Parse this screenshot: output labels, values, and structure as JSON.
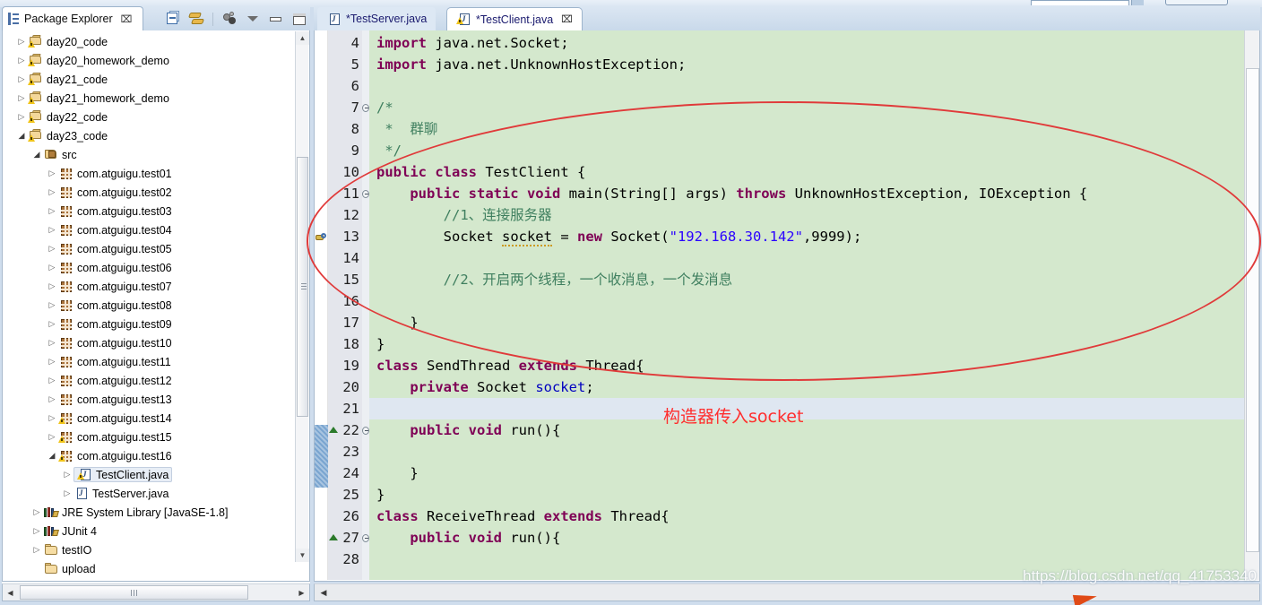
{
  "explorer": {
    "title": "Package Explorer",
    "close_glyph": "⌧",
    "tree": [
      {
        "label": "day20_code",
        "indent": 0,
        "arrow": "closed",
        "icon": "project-warning"
      },
      {
        "label": "day20_homework_demo",
        "indent": 0,
        "arrow": "closed",
        "icon": "project-warning"
      },
      {
        "label": "day21_code",
        "indent": 0,
        "arrow": "closed",
        "icon": "project-warning"
      },
      {
        "label": "day21_homework_demo",
        "indent": 0,
        "arrow": "closed",
        "icon": "project-warning"
      },
      {
        "label": "day22_code",
        "indent": 0,
        "arrow": "closed",
        "icon": "project-warning"
      },
      {
        "label": "day23_code",
        "indent": 0,
        "arrow": "open",
        "icon": "project-warning"
      },
      {
        "label": "src",
        "indent": 1,
        "arrow": "open",
        "icon": "source-folder"
      },
      {
        "label": "com.atguigu.test01",
        "indent": 2,
        "arrow": "closed",
        "icon": "package"
      },
      {
        "label": "com.atguigu.test02",
        "indent": 2,
        "arrow": "closed",
        "icon": "package"
      },
      {
        "label": "com.atguigu.test03",
        "indent": 2,
        "arrow": "closed",
        "icon": "package"
      },
      {
        "label": "com.atguigu.test04",
        "indent": 2,
        "arrow": "closed",
        "icon": "package"
      },
      {
        "label": "com.atguigu.test05",
        "indent": 2,
        "arrow": "closed",
        "icon": "package"
      },
      {
        "label": "com.atguigu.test06",
        "indent": 2,
        "arrow": "closed",
        "icon": "package"
      },
      {
        "label": "com.atguigu.test07",
        "indent": 2,
        "arrow": "closed",
        "icon": "package"
      },
      {
        "label": "com.atguigu.test08",
        "indent": 2,
        "arrow": "closed",
        "icon": "package"
      },
      {
        "label": "com.atguigu.test09",
        "indent": 2,
        "arrow": "closed",
        "icon": "package"
      },
      {
        "label": "com.atguigu.test10",
        "indent": 2,
        "arrow": "closed",
        "icon": "package"
      },
      {
        "label": "com.atguigu.test11",
        "indent": 2,
        "arrow": "closed",
        "icon": "package"
      },
      {
        "label": "com.atguigu.test12",
        "indent": 2,
        "arrow": "closed",
        "icon": "package"
      },
      {
        "label": "com.atguigu.test13",
        "indent": 2,
        "arrow": "closed",
        "icon": "package"
      },
      {
        "label": "com.atguigu.test14",
        "indent": 2,
        "arrow": "closed",
        "icon": "package-warning"
      },
      {
        "label": "com.atguigu.test15",
        "indent": 2,
        "arrow": "closed",
        "icon": "package-warning"
      },
      {
        "label": "com.atguigu.test16",
        "indent": 2,
        "arrow": "open",
        "icon": "package-warning"
      },
      {
        "label": "TestClient.java",
        "indent": 3,
        "arrow": "closed",
        "icon": "java-warning",
        "selected": true
      },
      {
        "label": "TestServer.java",
        "indent": 3,
        "arrow": "closed",
        "icon": "java"
      },
      {
        "label": "JRE System Library [JavaSE-1.8]",
        "indent": 1,
        "arrow": "closed",
        "icon": "library"
      },
      {
        "label": "JUnit 4",
        "indent": 1,
        "arrow": "closed",
        "icon": "library"
      },
      {
        "label": "testIO",
        "indent": 1,
        "arrow": "closed",
        "icon": "folder"
      },
      {
        "label": "upload",
        "indent": 1,
        "arrow": "none",
        "icon": "folder"
      }
    ]
  },
  "editor": {
    "close_glyph": "⌧",
    "tabs": [
      {
        "label": "*TestServer.java",
        "active": false,
        "dirty": true
      },
      {
        "label": "*TestClient.java",
        "active": true,
        "dirty": true
      }
    ],
    "first_visible_line": 4,
    "current_line": 21,
    "lines": [
      {
        "n": 4,
        "fold": false,
        "marker": "",
        "tokens": [
          {
            "t": "import ",
            "c": "kw"
          },
          {
            "t": "java.net.Socket;",
            "c": ""
          }
        ]
      },
      {
        "n": 5,
        "fold": false,
        "marker": "",
        "tokens": [
          {
            "t": "import ",
            "c": "kw"
          },
          {
            "t": "java.net.UnknownHostException;",
            "c": ""
          }
        ]
      },
      {
        "n": 6,
        "fold": false,
        "marker": "",
        "tokens": [
          {
            "t": "",
            "c": ""
          }
        ]
      },
      {
        "n": 7,
        "fold": true,
        "marker": "",
        "tokens": [
          {
            "t": "/*",
            "c": "cmt"
          }
        ]
      },
      {
        "n": 8,
        "fold": false,
        "marker": "",
        "tokens": [
          {
            "t": " *  群聊",
            "c": "cmt"
          }
        ]
      },
      {
        "n": 9,
        "fold": false,
        "marker": "",
        "tokens": [
          {
            "t": " */",
            "c": "cmt"
          }
        ]
      },
      {
        "n": 10,
        "fold": false,
        "marker": "",
        "tokens": [
          {
            "t": "public class ",
            "c": "kw"
          },
          {
            "t": "TestClient {",
            "c": ""
          }
        ]
      },
      {
        "n": 11,
        "fold": true,
        "marker": "",
        "tokens": [
          {
            "t": "    ",
            "c": ""
          },
          {
            "t": "public static void ",
            "c": "kw"
          },
          {
            "t": "main(String[] args) ",
            "c": ""
          },
          {
            "t": "throws ",
            "c": "kw"
          },
          {
            "t": "UnknownHostException, IOException {",
            "c": ""
          }
        ]
      },
      {
        "n": 12,
        "fold": false,
        "marker": "",
        "tokens": [
          {
            "t": "        //1、连接服务器",
            "c": "cmt"
          }
        ]
      },
      {
        "n": 13,
        "fold": false,
        "marker": "warning",
        "tokens": [
          {
            "t": "        Socket ",
            "c": ""
          },
          {
            "t": "socket",
            "c": "warnu"
          },
          {
            "t": " = ",
            "c": ""
          },
          {
            "t": "new ",
            "c": "kw"
          },
          {
            "t": "Socket(",
            "c": ""
          },
          {
            "t": "\"192.168.30.142\"",
            "c": "str"
          },
          {
            "t": ",9999);",
            "c": ""
          }
        ]
      },
      {
        "n": 14,
        "fold": false,
        "marker": "",
        "tokens": [
          {
            "t": "",
            "c": ""
          }
        ]
      },
      {
        "n": 15,
        "fold": false,
        "marker": "",
        "tokens": [
          {
            "t": "        //2、开启两个线程，一个收消息，一个发消息",
            "c": "cmt"
          }
        ]
      },
      {
        "n": 16,
        "fold": false,
        "marker": "",
        "tokens": [
          {
            "t": "",
            "c": ""
          }
        ]
      },
      {
        "n": 17,
        "fold": false,
        "marker": "",
        "tokens": [
          {
            "t": "    }",
            "c": ""
          }
        ]
      },
      {
        "n": 18,
        "fold": false,
        "marker": "",
        "tokens": [
          {
            "t": "}",
            "c": ""
          }
        ]
      },
      {
        "n": 19,
        "fold": false,
        "marker": "",
        "tokens": [
          {
            "t": "class ",
            "c": "kw"
          },
          {
            "t": "SendThread ",
            "c": ""
          },
          {
            "t": "extends ",
            "c": "kw"
          },
          {
            "t": "Thread{",
            "c": ""
          }
        ]
      },
      {
        "n": 20,
        "fold": false,
        "marker": "",
        "tokens": [
          {
            "t": "    ",
            "c": ""
          },
          {
            "t": "private ",
            "c": "kw"
          },
          {
            "t": "Socket ",
            "c": ""
          },
          {
            "t": "socket",
            "c": "fld"
          },
          {
            "t": ";",
            "c": ""
          }
        ]
      },
      {
        "n": 21,
        "fold": false,
        "marker": "",
        "tokens": [
          {
            "t": "",
            "c": ""
          }
        ]
      },
      {
        "n": 22,
        "fold": true,
        "marker": "up-arrow",
        "tokens": [
          {
            "t": "    ",
            "c": ""
          },
          {
            "t": "public void ",
            "c": "kw"
          },
          {
            "t": "run(){",
            "c": ""
          }
        ]
      },
      {
        "n": 23,
        "fold": false,
        "marker": "",
        "tokens": [
          {
            "t": "",
            "c": ""
          }
        ]
      },
      {
        "n": 24,
        "fold": false,
        "marker": "",
        "tokens": [
          {
            "t": "    }",
            "c": ""
          }
        ]
      },
      {
        "n": 25,
        "fold": false,
        "marker": "",
        "tokens": [
          {
            "t": "}",
            "c": ""
          }
        ]
      },
      {
        "n": 26,
        "fold": false,
        "marker": "",
        "tokens": [
          {
            "t": "class ",
            "c": "kw"
          },
          {
            "t": "ReceiveThread ",
            "c": ""
          },
          {
            "t": "extends ",
            "c": "kw"
          },
          {
            "t": "Thread{",
            "c": ""
          }
        ]
      },
      {
        "n": 27,
        "fold": true,
        "marker": "up-arrow",
        "tokens": [
          {
            "t": "    ",
            "c": ""
          },
          {
            "t": "public void ",
            "c": "kw"
          },
          {
            "t": "run(){",
            "c": ""
          }
        ]
      },
      {
        "n": 28,
        "fold": false,
        "marker": "",
        "tokens": [
          {
            "t": "",
            "c": ""
          }
        ]
      }
    ]
  },
  "annotations": {
    "text": "构造器传入socket",
    "ellipse_color": "#e03a3a",
    "text_color": "#ff2d2d"
  },
  "watermark": {
    "url": "https://blog.csdn.net/qq_41753340"
  },
  "theme": {
    "editor_background": "#d4e8cd",
    "current_line_background": "#dfe7f1",
    "gutter_background": "#e4e6ec",
    "keyword_color": "#7f0055",
    "comment_color": "#3f7f5f",
    "string_color": "#2a00ff",
    "field_color": "#0000c0"
  }
}
